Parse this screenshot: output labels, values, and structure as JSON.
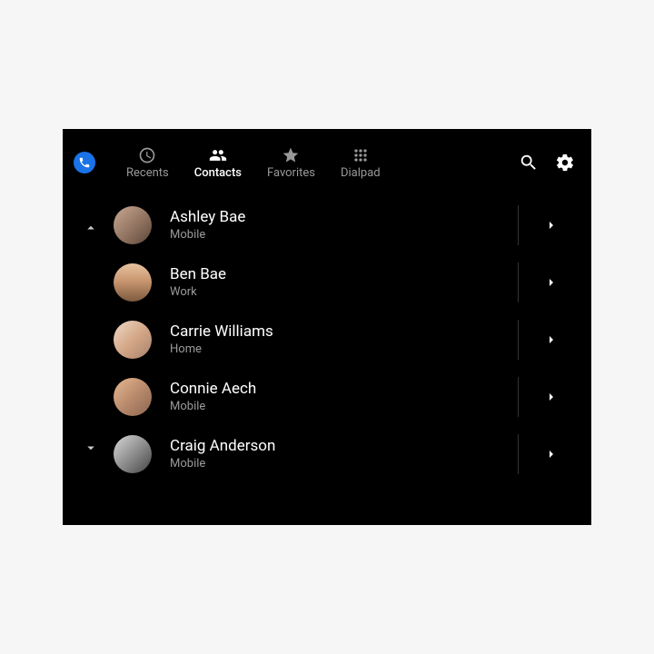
{
  "tabs": {
    "recents": "Recents",
    "contacts": "Contacts",
    "favorites": "Favorites",
    "dialpad": "Dialpad"
  },
  "activeTab": "contacts",
  "contacts": [
    {
      "name": "Ashley Bae",
      "type": "Mobile"
    },
    {
      "name": "Ben Bae",
      "type": "Work"
    },
    {
      "name": "Carrie Williams",
      "type": "Home"
    },
    {
      "name": "Connie Aech",
      "type": "Mobile"
    },
    {
      "name": "Craig Anderson",
      "type": "Mobile"
    }
  ]
}
